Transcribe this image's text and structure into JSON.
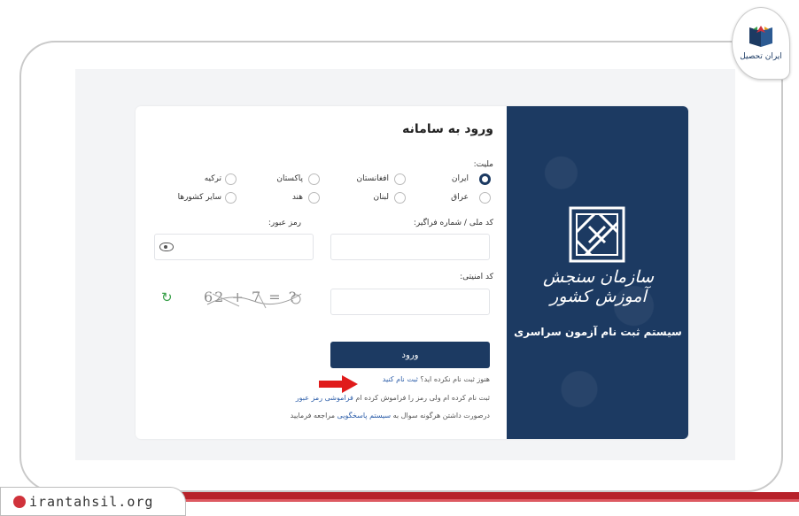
{
  "logo_badge": {
    "text": "ایران تحصیل"
  },
  "site_badge": {
    "text": "irantahsil.org"
  },
  "brand": {
    "script_text": "سازمان سنجش آموزش کشور",
    "system_title": "سیستم ثبت نام آزمون سراسری"
  },
  "form": {
    "title": "ورود به سامانه",
    "nationality_label": "ملیت:",
    "nationality_options": [
      {
        "label": "ایران",
        "selected": true
      },
      {
        "label": "افغانستان",
        "selected": false
      },
      {
        "label": "پاکستان",
        "selected": false
      },
      {
        "label": "ترکیه",
        "selected": false
      },
      {
        "label": "عراق",
        "selected": false
      },
      {
        "label": "لبنان",
        "selected": false
      },
      {
        "label": "هند",
        "selected": false
      },
      {
        "label": "سایر کشورها",
        "selected": false
      }
    ],
    "national_code_label": "کد ملی / شماره فراگیر:",
    "password_label": "رمز عبور:",
    "security_code_label": "کد امنیتی:",
    "captcha_text": "62 + 7 = ?",
    "login_button": "ورود",
    "register_prompt": "هنوز ثبت نام نکرده اید؟",
    "register_link": "ثبت نام کنید",
    "forgot_prompt": "ثبت نام کرده ام ولی رمز را فراموش کرده ام",
    "forgot_link": "فراموشی رمز عبور",
    "help_prompt_before": "درصورت داشتن هرگونه سوال به",
    "help_link": "سیستم پاسخگویی",
    "help_prompt_after": "مراجعه فرمایید"
  },
  "colors": {
    "brand_navy": "#1c3a62",
    "accent_red": "#b7222a",
    "refresh_green": "#3aa04a",
    "arrow_red": "#e01b1b"
  }
}
